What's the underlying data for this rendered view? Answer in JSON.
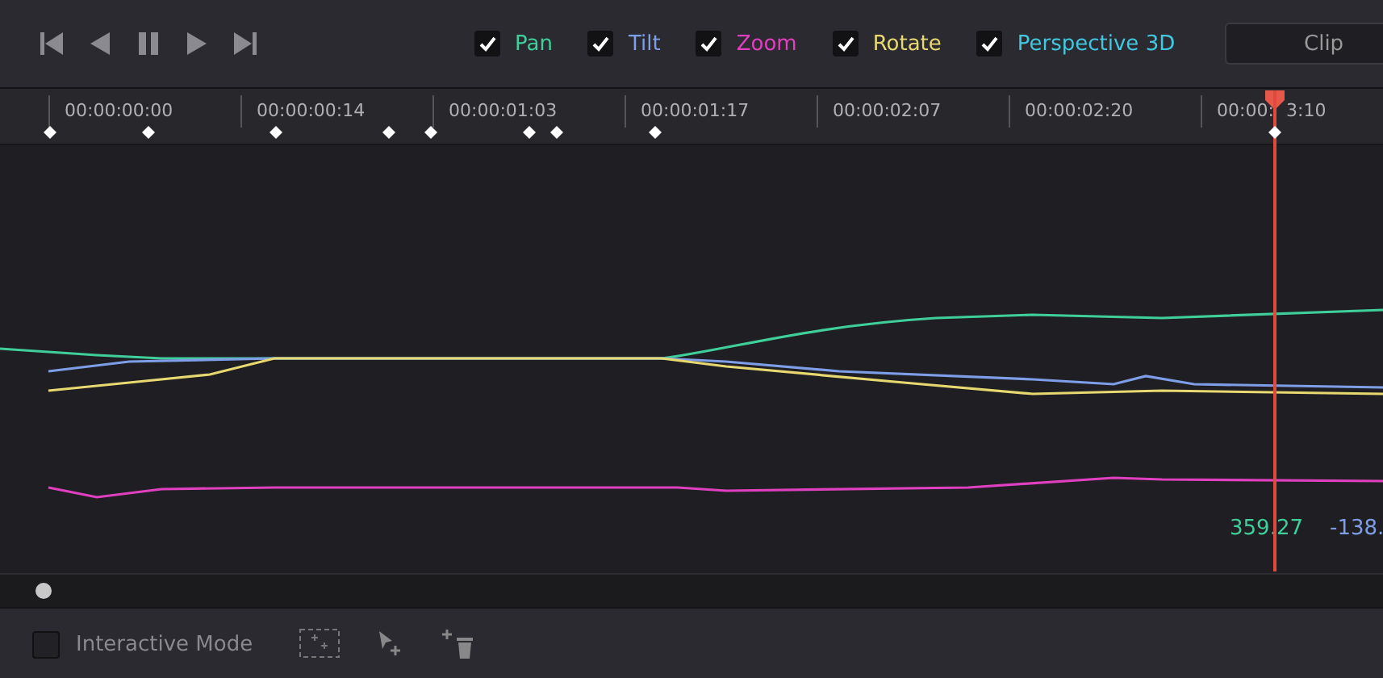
{
  "transport": {
    "buttons": [
      {
        "kind": "first"
      },
      {
        "kind": "back"
      },
      {
        "kind": "pause"
      },
      {
        "kind": "play"
      },
      {
        "kind": "last"
      }
    ]
  },
  "channels": [
    {
      "label": "Pan",
      "checked": true,
      "color": "#3fcf9a"
    },
    {
      "label": "Tilt",
      "checked": true,
      "color": "#7f9ee8"
    },
    {
      "label": "Zoom",
      "checked": true,
      "color": "#e040c0"
    },
    {
      "label": "Rotate",
      "checked": true,
      "color": "#e8d870"
    },
    {
      "label": "Perspective 3D",
      "checked": true,
      "color": "#40c8e0"
    }
  ],
  "clip_button": "Clip",
  "ruler": {
    "labels": [
      "00:00:00:00",
      "00:00:00:14",
      "00:00:01:03",
      "00:00:01:17",
      "00:00:02:07",
      "00:00:02:20"
    ],
    "last_label_left": "00:00:",
    "last_label_right": "3:10"
  },
  "readouts": [
    {
      "text": "359.27",
      "color": "#3fcf9a"
    },
    {
      "text": "-138.",
      "color": "#7f9ee8"
    }
  ],
  "bottom": {
    "interactive_mode": {
      "label": "Interactive Mode",
      "checked": false
    }
  }
}
